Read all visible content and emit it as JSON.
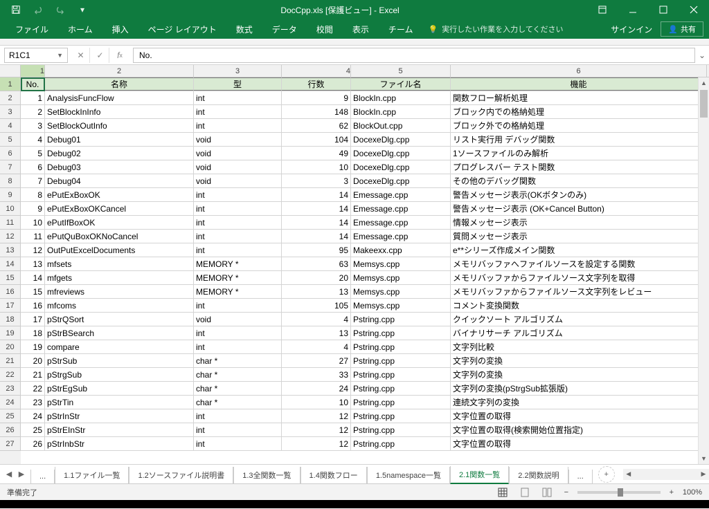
{
  "title": "DocCpp.xls [保護ビュー] - Excel",
  "ribbon": {
    "tabs": [
      "ファイル",
      "ホーム",
      "挿入",
      "ページ レイアウト",
      "数式",
      "データ",
      "校閲",
      "表示",
      "チーム"
    ],
    "tell_me": "実行したい作業を入力してください",
    "sign_in": "サインイン",
    "share": "共有"
  },
  "name_box": "R1C1",
  "formula": "No.",
  "columns": [
    "1",
    "2",
    "3",
    "4",
    "5",
    "6"
  ],
  "header_row": [
    "No.",
    "名称",
    "型",
    "行数",
    "ファイル名",
    "機能"
  ],
  "rows": [
    {
      "no": "1",
      "name": "AnalysisFuncFlow",
      "type": "int",
      "lines": "9",
      "file": "BlockIn.cpp",
      "func": "関数フロー解析処理"
    },
    {
      "no": "2",
      "name": "SetBlockInInfo",
      "type": "int",
      "lines": "148",
      "file": "BlockIn.cpp",
      "func": "ブロック内での格納処理"
    },
    {
      "no": "3",
      "name": "SetBlockOutInfo",
      "type": "int",
      "lines": "62",
      "file": "BlockOut.cpp",
      "func": "ブロック外での格納処理"
    },
    {
      "no": "4",
      "name": "Debug01",
      "type": "void",
      "lines": "104",
      "file": "DocexeDlg.cpp",
      "func": "リスト実行用 デバッグ関数"
    },
    {
      "no": "5",
      "name": "Debug02",
      "type": "void",
      "lines": "49",
      "file": "DocexeDlg.cpp",
      "func": "1ソースファイルのみ解析"
    },
    {
      "no": "6",
      "name": "Debug03",
      "type": "void",
      "lines": "10",
      "file": "DocexeDlg.cpp",
      "func": "プログレスバー テスト関数"
    },
    {
      "no": "7",
      "name": "Debug04",
      "type": "void",
      "lines": "3",
      "file": "DocexeDlg.cpp",
      "func": "その他のデバッグ関数"
    },
    {
      "no": "8",
      "name": "ePutExBoxOK",
      "type": "int",
      "lines": "14",
      "file": "Emessage.cpp",
      "func": "警告メッセージ表示(OKボタンのみ)"
    },
    {
      "no": "9",
      "name": "ePutExBoxOKCancel",
      "type": "int",
      "lines": "14",
      "file": "Emessage.cpp",
      "func": "警告メッセージ表示 (OK+Cancel Button)"
    },
    {
      "no": "10",
      "name": "ePutIfBoxOK",
      "type": "int",
      "lines": "14",
      "file": "Emessage.cpp",
      "func": "情報メッセージ表示"
    },
    {
      "no": "11",
      "name": "ePutQuBoxOKNoCancel",
      "type": "int",
      "lines": "14",
      "file": "Emessage.cpp",
      "func": "質問メッセージ表示"
    },
    {
      "no": "12",
      "name": "OutPutExcelDocuments",
      "type": "int",
      "lines": "95",
      "file": "Makeexx.cpp",
      "func": "e**シリーズ作成メイン関数"
    },
    {
      "no": "13",
      "name": "mfsets",
      "type": "MEMORY *",
      "lines": "63",
      "file": "Memsys.cpp",
      "func": "メモリバッファへファイルソースを設定する関数"
    },
    {
      "no": "14",
      "name": "mfgets",
      "type": "MEMORY *",
      "lines": "20",
      "file": "Memsys.cpp",
      "func": "メモリバッファからファイルソース文字列を取得"
    },
    {
      "no": "15",
      "name": "mfreviews",
      "type": "MEMORY *",
      "lines": "13",
      "file": "Memsys.cpp",
      "func": "メモリバッファからファイルソース文字列をレビュー"
    },
    {
      "no": "16",
      "name": "mfcoms",
      "type": "int",
      "lines": "105",
      "file": "Memsys.cpp",
      "func": "コメント変換関数"
    },
    {
      "no": "17",
      "name": "pStrQSort",
      "type": "void",
      "lines": "4",
      "file": "Pstring.cpp",
      "func": "クイックソート アルゴリズム"
    },
    {
      "no": "18",
      "name": "pStrBSearch",
      "type": "int",
      "lines": "13",
      "file": "Pstring.cpp",
      "func": "バイナリサーチ アルゴリズム"
    },
    {
      "no": "19",
      "name": "compare",
      "type": "int",
      "lines": "4",
      "file": "Pstring.cpp",
      "func": "文字列比較"
    },
    {
      "no": "20",
      "name": "pStrSub",
      "type": "char *",
      "lines": "27",
      "file": "Pstring.cpp",
      "func": "文字列の変換"
    },
    {
      "no": "21",
      "name": "pStrgSub",
      "type": "char *",
      "lines": "33",
      "file": "Pstring.cpp",
      "func": "文字列の変換"
    },
    {
      "no": "22",
      "name": "pStrEgSub",
      "type": "char *",
      "lines": "24",
      "file": "Pstring.cpp",
      "func": "文字列の変換(pStrgSub拡張版)"
    },
    {
      "no": "23",
      "name": "pStrTin",
      "type": "char *",
      "lines": "10",
      "file": "Pstring.cpp",
      "func": "連続文字列の変換"
    },
    {
      "no": "24",
      "name": "pStrInStr",
      "type": "int",
      "lines": "12",
      "file": "Pstring.cpp",
      "func": "文字位置の取得"
    },
    {
      "no": "25",
      "name": "pStrEInStr",
      "type": "int",
      "lines": "12",
      "file": "Pstring.cpp",
      "func": "文字位置の取得(検索開始位置指定)"
    },
    {
      "no": "26",
      "name": "pStrInbStr",
      "type": "int",
      "lines": "12",
      "file": "Pstring.cpp",
      "func": "文字位置の取得"
    }
  ],
  "sheet_tabs": {
    "items": [
      "...",
      "1.1ファイル一覧",
      "1.2ソースファイル説明書",
      "1.3全関数一覧",
      "1.4関数フロー",
      "1.5namespace一覧",
      "2.1関数一覧",
      "2.2関数説明",
      "..."
    ],
    "active_index": 6
  },
  "status": {
    "ready": "準備完了",
    "zoom": "100%"
  }
}
